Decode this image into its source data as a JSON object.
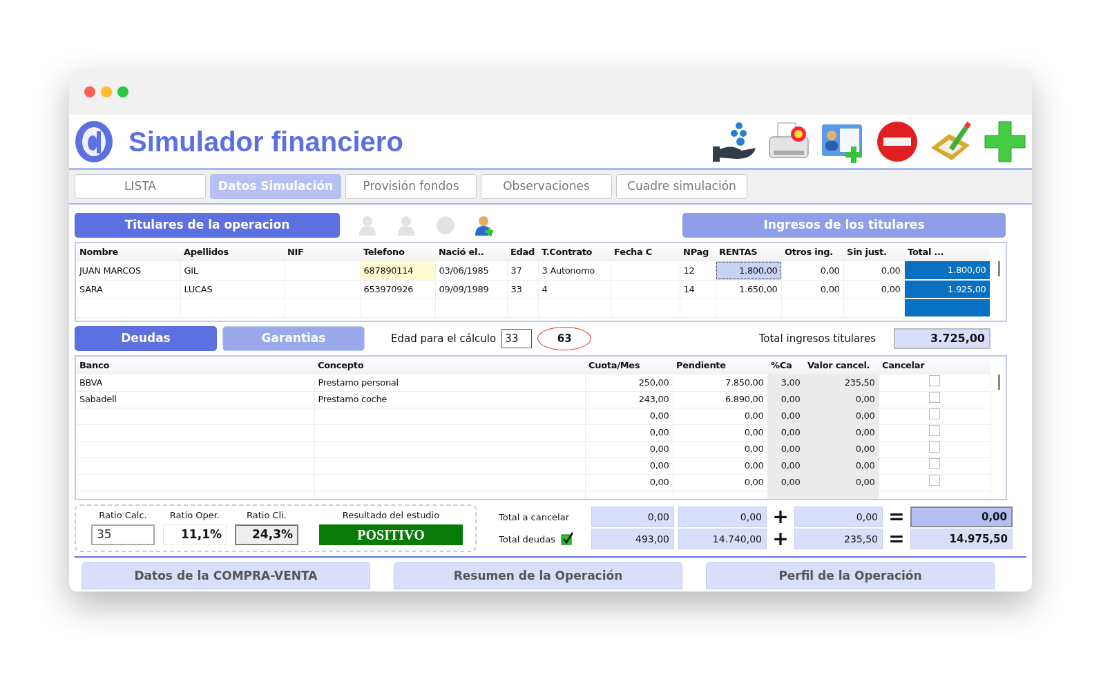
{
  "app": {
    "title": "Simulador financiero"
  },
  "tabs": [
    {
      "label": "LISTA",
      "selected": false
    },
    {
      "label": "Datos Simulación",
      "selected": true
    },
    {
      "label": "Provisión fondos",
      "selected": false
    },
    {
      "label": "Observaciones",
      "selected": false
    },
    {
      "label": "Cuadre simulación",
      "selected": false
    }
  ],
  "titulares": {
    "heading": "Titulares de la operacion",
    "tools": [
      {
        "disabled": true
      },
      {
        "disabled": true
      },
      {
        "disabled": true
      },
      {
        "disabled": false
      }
    ],
    "ingresos_heading": "Ingresos de los titulares",
    "columns": [
      {
        "label": "Nombre",
        "kind": "text"
      },
      {
        "label": "Apellidos",
        "kind": "text"
      },
      {
        "label": "NIF",
        "kind": "text"
      },
      {
        "label": "Telefono",
        "kind": "edit"
      },
      {
        "label": "Nació el..",
        "kind": "text"
      },
      {
        "label": "Edad",
        "kind": "text"
      },
      {
        "label": "T.Contrato",
        "kind": "text"
      },
      {
        "label": "Fecha C",
        "kind": "text"
      },
      {
        "label": "NPag",
        "kind": "text"
      },
      {
        "label": "RENTAS",
        "kind": "current"
      },
      {
        "label": "Otros ing.",
        "kind": "num"
      },
      {
        "label": "Sin just.",
        "kind": "num"
      },
      {
        "label": "Total ...",
        "kind": "total"
      }
    ],
    "rows": [
      {
        "nombre": "JUAN MARCOS",
        "apellidos": "GIL",
        "telefono": "687890114",
        "nacio": "03/06/1985",
        "edad": "37",
        "contrato": "3 Autonomo",
        "npag": "12",
        "rentas": "1.800,00",
        "otros": "0,00",
        "sinjust": "0,00",
        "total": "1.800,00",
        "selected": true
      },
      {
        "nombre": "SARA",
        "apellidos": "LUCAS",
        "telefono": "653970926",
        "nacio": "09/09/1989",
        "edad": "33",
        "contrato": "4",
        "npag": "14",
        "rentas": "1.650,00",
        "otros": "0,00",
        "sinjust": "0,00",
        "total": "1.925,00",
        "selected": false
      }
    ]
  },
  "subtabs": [
    {
      "label": "Deudas",
      "selected": true
    },
    {
      "label": "Garantias",
      "selected": false
    }
  ],
  "edad_calculo": {
    "label": "Edad para el cálculo",
    "value": "33",
    "circled": "63"
  },
  "total_ingresos": {
    "label": "Total ingresos titulares",
    "value": "3.725,00"
  },
  "deudas": {
    "columns": [
      {
        "label": "Banco",
        "kind": "text"
      },
      {
        "label": "Concepto",
        "kind": "text"
      },
      {
        "label": "Cuota/Mes",
        "kind": "num"
      },
      {
        "label": "Pendiente",
        "kind": "num"
      },
      {
        "label": "%Ca",
        "kind": "shaded"
      },
      {
        "label": "Valor cancel.",
        "kind": "shaded"
      },
      {
        "label": "Cancelar",
        "kind": "check"
      }
    ],
    "rows": [
      {
        "banco": "BBVA",
        "concepto": "Prestamo personal",
        "cuota": "250,00",
        "pendiente": "7.850,00",
        "ca": "3,00",
        "valor": "235,50",
        "cancelar": false
      },
      {
        "banco": "Sabadell",
        "concepto": "Prestamo coche",
        "cuota": "243,00",
        "pendiente": "6.890,00",
        "ca": "0,00",
        "valor": "0,00",
        "cancelar": false
      },
      {
        "cuota": "0,00",
        "pendiente": "0,00",
        "ca": "0,00",
        "valor": "0,00",
        "cancelar": false
      },
      {
        "cuota": "0,00",
        "pendiente": "0,00",
        "ca": "0,00",
        "valor": "0,00",
        "cancelar": false
      },
      {
        "cuota": "0,00",
        "pendiente": "0,00",
        "ca": "0,00",
        "valor": "0,00",
        "cancelar": false
      },
      {
        "cuota": "0,00",
        "pendiente": "0,00",
        "ca": "0,00",
        "valor": "0,00",
        "cancelar": false
      },
      {
        "cuota": "0,00",
        "pendiente": "0,00",
        "ca": "0,00",
        "valor": "0,00",
        "cancelar": false
      }
    ]
  },
  "ratios": [
    {
      "label": "Ratio Calc.",
      "value": "35",
      "kind": "input"
    },
    {
      "label": "Ratio Oper.",
      "value": "11,1%",
      "kind": "plain"
    },
    {
      "label": "Ratio Cli.",
      "value": "24,3%",
      "kind": "sunken"
    }
  ],
  "resultado": {
    "label": "Resultado del estudio",
    "value": "POSITIVO"
  },
  "totales": [
    {
      "label": "Total a cancelar",
      "values": [
        "0,00",
        "0,00"
      ],
      "plus": "+",
      "addend": "0,00",
      "equals": "=",
      "result": "0,00",
      "highlight": true
    },
    {
      "label": "Total deudas",
      "checked": true,
      "values": [
        "493,00",
        "14.740,00"
      ],
      "plus": "+",
      "addend": "235,50",
      "equals": "=",
      "result": "14.975,50",
      "highlight": false
    }
  ],
  "bottom_tabs": [
    "Datos de la COMPRA-VENTA",
    "Resumen de la Operación",
    "Perfil de la Operación"
  ]
}
